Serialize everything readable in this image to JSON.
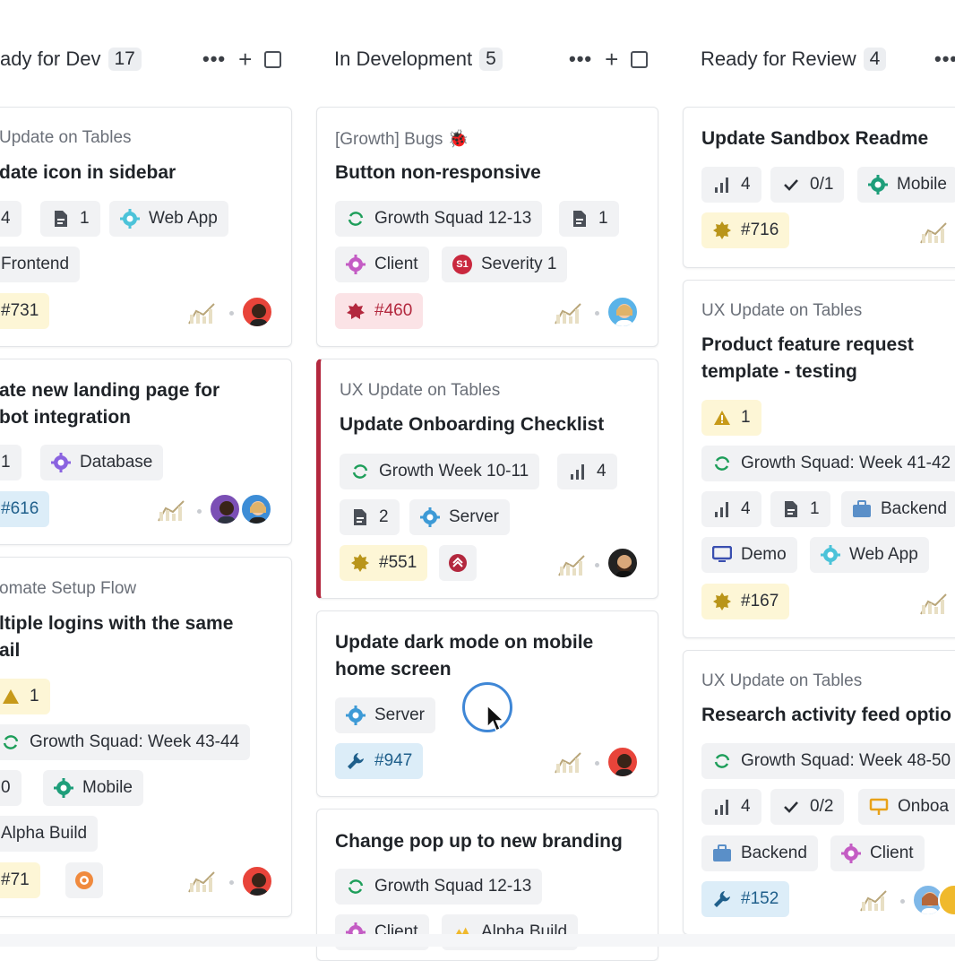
{
  "columns": [
    {
      "title": "ady for Dev",
      "count": "17"
    },
    {
      "title": "In Development",
      "count": "5"
    },
    {
      "title": "Ready for Review",
      "count": "4"
    }
  ],
  "col1": {
    "c1": {
      "subtitle": "Update on Tables",
      "title": "date icon in sidebar",
      "p_points": "4",
      "p_docs": "1",
      "p_webapp": "Web App",
      "p_frontend": "Frontend",
      "p_id": "#731"
    },
    "c2": {
      "title1": "ate new landing page for",
      "title2": "bot integration",
      "p_docs": "1",
      "p_database": "Database",
      "p_id": "#616"
    },
    "c3": {
      "subtitle": "omate Setup Flow",
      "title1": "ltiple logins with the same",
      "title2": "ail",
      "p_warn": "1",
      "p_growth": "Growth Squad: Week 43-44",
      "p_points": "0",
      "p_mobile": "Mobile",
      "p_alpha": "Alpha Build",
      "p_id": "#71"
    }
  },
  "col2": {
    "c1": {
      "subtitle": "[Growth] Bugs 🐞",
      "title": "Button non-responsive",
      "p_growth": "Growth Squad 12-13",
      "p_docs": "1",
      "p_client": "Client",
      "p_severity": "Severity 1",
      "sev_badge": "S1",
      "p_id": "#460"
    },
    "c2": {
      "subtitle": "UX Update on Tables",
      "title": "Update Onboarding Checklist",
      "p_growth": "Growth Week 10-11",
      "p_points": "4",
      "p_docs": "2",
      "p_server": "Server",
      "p_id": "#551"
    },
    "c3": {
      "title1": "Update dark mode on mobile",
      "title2": "home screen",
      "p_server": "Server",
      "p_id": "#947"
    },
    "c4": {
      "title": "Change pop up to new branding",
      "p_growth": "Growth Squad 12-13",
      "p_client": "Client",
      "p_alpha": "Alpha Build"
    }
  },
  "col3": {
    "c1": {
      "title": "Update Sandbox Readme",
      "p_points": "4",
      "p_checks": "0/1",
      "p_mobile": "Mobile",
      "p_id": "#716"
    },
    "c2": {
      "subtitle": "UX Update on Tables",
      "title1": "Product feature request",
      "title2": "template - testing",
      "p_warn": "1",
      "p_growth": "Growth Squad: Week 41-42",
      "p_points": "4",
      "p_docs": "1",
      "p_backend": "Backend",
      "p_demo": "Demo",
      "p_webapp": "Web App",
      "p_id": "#167"
    },
    "c3": {
      "subtitle": "UX Update on Tables",
      "title": "Research activity feed optio",
      "p_growth": "Growth Squad: Week 48-50",
      "p_points": "4",
      "p_checks": "0/2",
      "p_onboard": "Onboa",
      "p_backend": "Backend",
      "p_client": "Client",
      "p_id": "#152"
    }
  },
  "colors": {
    "accent_red": "#b3283e",
    "link_blue": "#3f87d6",
    "growth_green": "#1e9e5a"
  }
}
